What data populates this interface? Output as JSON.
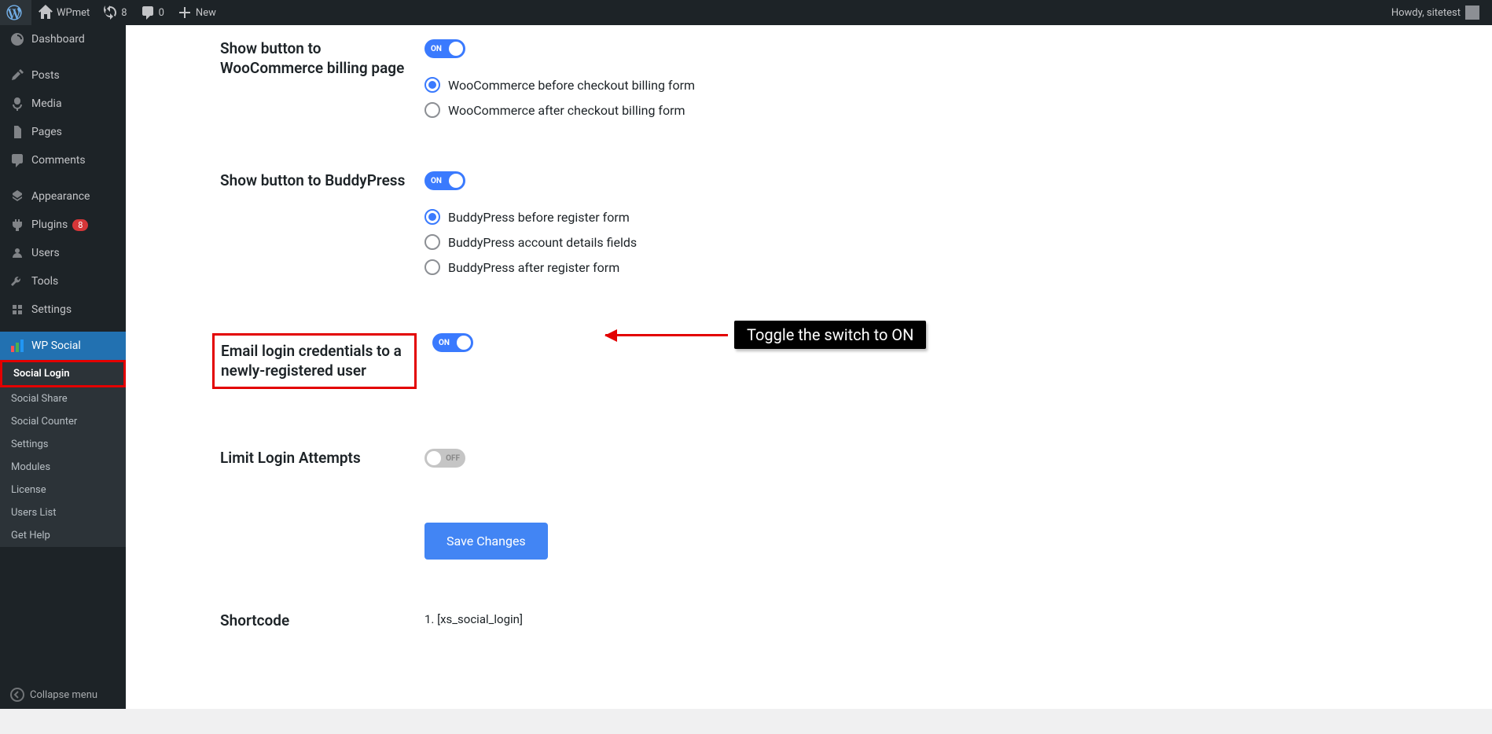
{
  "adminbar": {
    "site_name": "WPmet",
    "updates": "8",
    "comments": "0",
    "new_label": "New",
    "howdy": "Howdy, sitetest"
  },
  "sidebar": {
    "dashboard": "Dashboard",
    "posts": "Posts",
    "media": "Media",
    "pages": "Pages",
    "comments": "Comments",
    "appearance": "Appearance",
    "plugins": "Plugins",
    "plugins_badge": "8",
    "users": "Users",
    "tools": "Tools",
    "settings": "Settings",
    "wp_social": "WP Social",
    "submenu": {
      "social_login": "Social Login",
      "social_share": "Social Share",
      "social_counter": "Social Counter",
      "settings": "Settings",
      "modules": "Modules",
      "license": "License",
      "users_list": "Users List",
      "get_help": "Get Help"
    },
    "collapse": "Collapse menu"
  },
  "settings": {
    "woo_billing": {
      "label": "Show button to WooCommerce billing page",
      "toggle_text": "ON",
      "opt1": "WooCommerce before checkout billing form",
      "opt2": "WooCommerce after checkout billing form"
    },
    "buddypress": {
      "label": "Show button to BuddyPress",
      "toggle_text": "ON",
      "opt1": "BuddyPress before register form",
      "opt2": "BuddyPress account details fields",
      "opt3": "BuddyPress after register form"
    },
    "email_creds": {
      "label": "Email login credentials to a newly-registered user",
      "toggle_text": "ON"
    },
    "limit_login": {
      "label": "Limit Login Attempts",
      "toggle_text": "OFF"
    },
    "save_button": "Save Changes",
    "shortcode": {
      "label": "Shortcode",
      "value": "1. [xs_social_login]"
    }
  },
  "annotation": {
    "text": "Toggle the switch to ON"
  }
}
